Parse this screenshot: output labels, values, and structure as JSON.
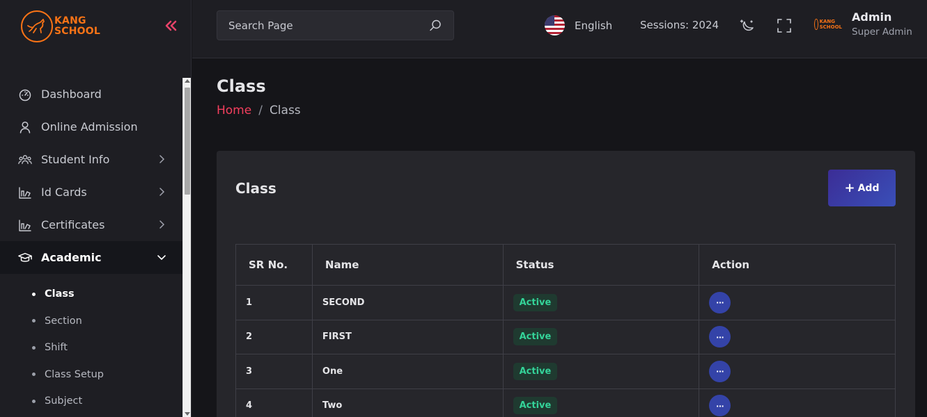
{
  "brand": {
    "line1": "KANG",
    "line2": "SCHOOL"
  },
  "sidebar": {
    "collapse_icon": "double-chevron-left-icon",
    "items": [
      {
        "label": "Dashboard",
        "icon": "gauge-icon"
      },
      {
        "label": "Online Admission",
        "icon": "user-icon"
      },
      {
        "label": "Student Info",
        "icon": "users-icon",
        "has_children": true
      },
      {
        "label": "Id Cards",
        "icon": "id-card-icon",
        "has_children": true
      },
      {
        "label": "Certificates",
        "icon": "certificate-icon",
        "has_children": true
      },
      {
        "label": "Academic",
        "icon": "graduation-cap-icon",
        "has_children": true,
        "expanded": true
      }
    ],
    "sub_items": [
      "Class",
      "Section",
      "Shift",
      "Class Setup",
      "Subject"
    ],
    "active_sub": "Class"
  },
  "topbar": {
    "search_placeholder": "Search Page",
    "language": "English",
    "sessions": "Sessions: 2024",
    "user_name": "Admin",
    "user_role": "Super Admin",
    "avatar_text": "KANG SCHOOL"
  },
  "page": {
    "title": "Class",
    "breadcrumb_home": "Home",
    "breadcrumb_sep": "/",
    "breadcrumb_current": "Class"
  },
  "card": {
    "title": "Class",
    "add_label": "Add",
    "columns": [
      "SR No.",
      "Name",
      "Status",
      "Action"
    ],
    "rows": [
      {
        "sr": "1",
        "name": "SECOND",
        "status": "Active"
      },
      {
        "sr": "2",
        "name": "FIRST",
        "status": "Active"
      },
      {
        "sr": "3",
        "name": "One",
        "status": "Active"
      },
      {
        "sr": "4",
        "name": "Two",
        "status": "Active"
      }
    ],
    "action_label": "···"
  },
  "colors": {
    "accent": "#f43f5e",
    "brand": "#f97316",
    "primary_button": "#3443a8",
    "status_active": "#34d399"
  }
}
